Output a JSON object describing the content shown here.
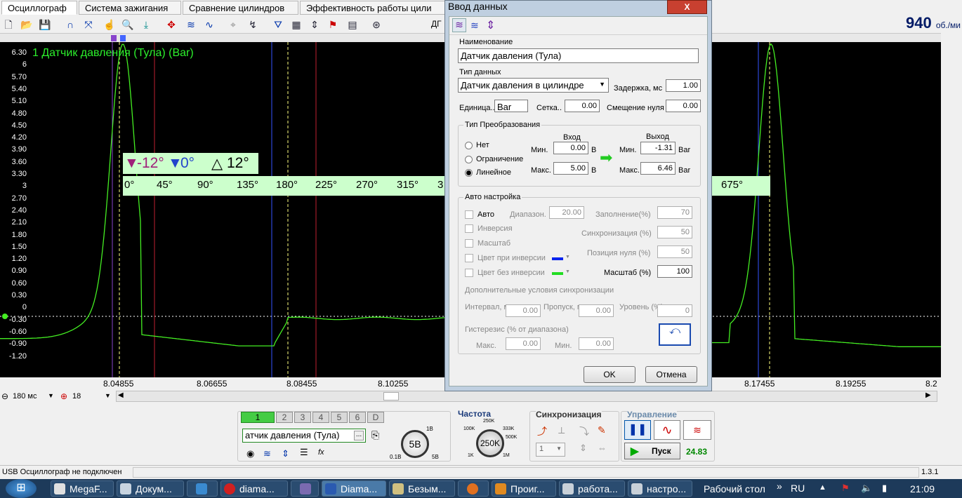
{
  "tabs": [
    "Осциллограф",
    "Система зажигания",
    "Сравнение цилиндров",
    "Эффективность работы цили"
  ],
  "toolbar": {
    "ab_label": "ДГ",
    "rpm_value": "940",
    "rpm_unit": "об./ми"
  },
  "scope": {
    "channel_title": "1 Датчик давления  (Тула) (Bar)",
    "y_ticks": [
      "6.30",
      "6",
      "5.70",
      "5.40",
      "5.10",
      "4.80",
      "4.50",
      "4.20",
      "3.90",
      "3.60",
      "3.30",
      "3",
      "2.70",
      "2.40",
      "2.10",
      "1.80",
      "1.50",
      "1.20",
      "0.90",
      "0.60",
      "0.30",
      "0",
      "-0.30",
      "-0.60",
      "-0.90",
      "-1.20"
    ],
    "x_ticks": [
      "8.04855",
      "8.06655",
      "8.08455",
      "8.10255",
      "8.17455",
      "8.19255",
      "8.2"
    ],
    "angle_a": "-12°",
    "angle_b": "0°",
    "angle_delta": "12°",
    "degree_scale": [
      "0°",
      "45°",
      "90°",
      "135°",
      "180°",
      "225°",
      "270°",
      "315°",
      "3",
      "675°"
    ],
    "colors": {
      "trace": "#44ee22",
      "background": "#000000",
      "marker_blue": "#3355ff",
      "marker_red": "#c02030",
      "marker_yellow": "#ffff80"
    }
  },
  "zoom": {
    "time_value": "180 мс",
    "count_value": "18"
  },
  "controls": {
    "channel_buttons": [
      "1",
      "2",
      "3",
      "4",
      "5",
      "6",
      "D"
    ],
    "channel_select": "атчик давления  (Тула)",
    "channel_select_btn": "...",
    "volt_knob": "5В",
    "volt_min": "0.1В",
    "volt_max": "5В",
    "volt_top": "1В",
    "freq_title": "Частота",
    "freq_knob": "250K",
    "freq_ticks": [
      "100K",
      "250K",
      "333K",
      "500K",
      "1K",
      "1M"
    ],
    "sync_title": "Синхронизация",
    "sync_select": "1",
    "control_title": "Управление",
    "start_btn": "Пуск",
    "fps_value": "24.83"
  },
  "status": {
    "text": "USB Осциллограф не подключен",
    "version": "1.3.1"
  },
  "taskbar": {
    "tasks": [
      "MegaF...",
      "Докум...",
      "",
      "diama...",
      "",
      "Diama...",
      "Безым...",
      "",
      "Проиг...",
      "работа...",
      "настро..."
    ],
    "desktop": "Рабочий стол",
    "lang": "RU",
    "time": "21:09"
  },
  "dialog": {
    "title": "Ввод данных",
    "close": "X",
    "name_label": "Наименование",
    "name_value": "Датчик давления  (Тула)",
    "type_label": "Тип данных",
    "type_value": "Датчик давления в цилиндре",
    "delay_label": "Задержка, мс",
    "delay_value": "1.00",
    "units_label": "Единица..",
    "units_value": "Bar",
    "grid_label": "Сетка..",
    "grid_value": "0.00",
    "offset_label": "Смещение нуля",
    "offset_value": "0.00",
    "conv_title": "Тип Преобразования",
    "radio_none": "Нет",
    "radio_limit": "Ограничение",
    "radio_linear": "Линейное",
    "in_title": "Вход",
    "out_title": "Выход",
    "min_label": "Мин.",
    "max_label": "Макс.",
    "in_min": "0.00",
    "in_max": "5.00",
    "in_unit": "В",
    "out_min": "-1.31",
    "out_max": "6.46",
    "out_unit": "Bar",
    "auto_title": "Авто настройка",
    "auto_label": "Авто",
    "range_label": "Диапазон.",
    "range_value": "20.00",
    "fill_label": "Заполнение(%)",
    "fill_value": "70",
    "inv_label": "Инверсия",
    "sync_label": "Синхронизация (%)",
    "sync_value": "50",
    "scale_chk_label": "Масштаб",
    "zero_label": "Позиция нуля (%)",
    "zero_value": "50",
    "color_inv_label": "Цвет при инверсии",
    "color_noinv_label": "Цвет без инверсии",
    "scale_label": "Масштаб (%)",
    "scale_value": "100",
    "extra_label": "Дополнительные условия синхронизации",
    "interval_label": "Интервал, мс",
    "interval_value": "0.00",
    "skip_label": "Пропуск, мс",
    "skip_value": "0.00",
    "level_label": "Уровень (%)",
    "level_value": "0",
    "hyst_label": "Гистерезис (% от диапазона)",
    "hyst_max_label": "Макс.",
    "hyst_max_value": "0.00",
    "hyst_min_label": "Мин.",
    "hyst_min_value": "0.00",
    "ok": "OK",
    "cancel": "Отмена",
    "color_inv": "#0022ee",
    "color_noinv": "#22dd22"
  }
}
